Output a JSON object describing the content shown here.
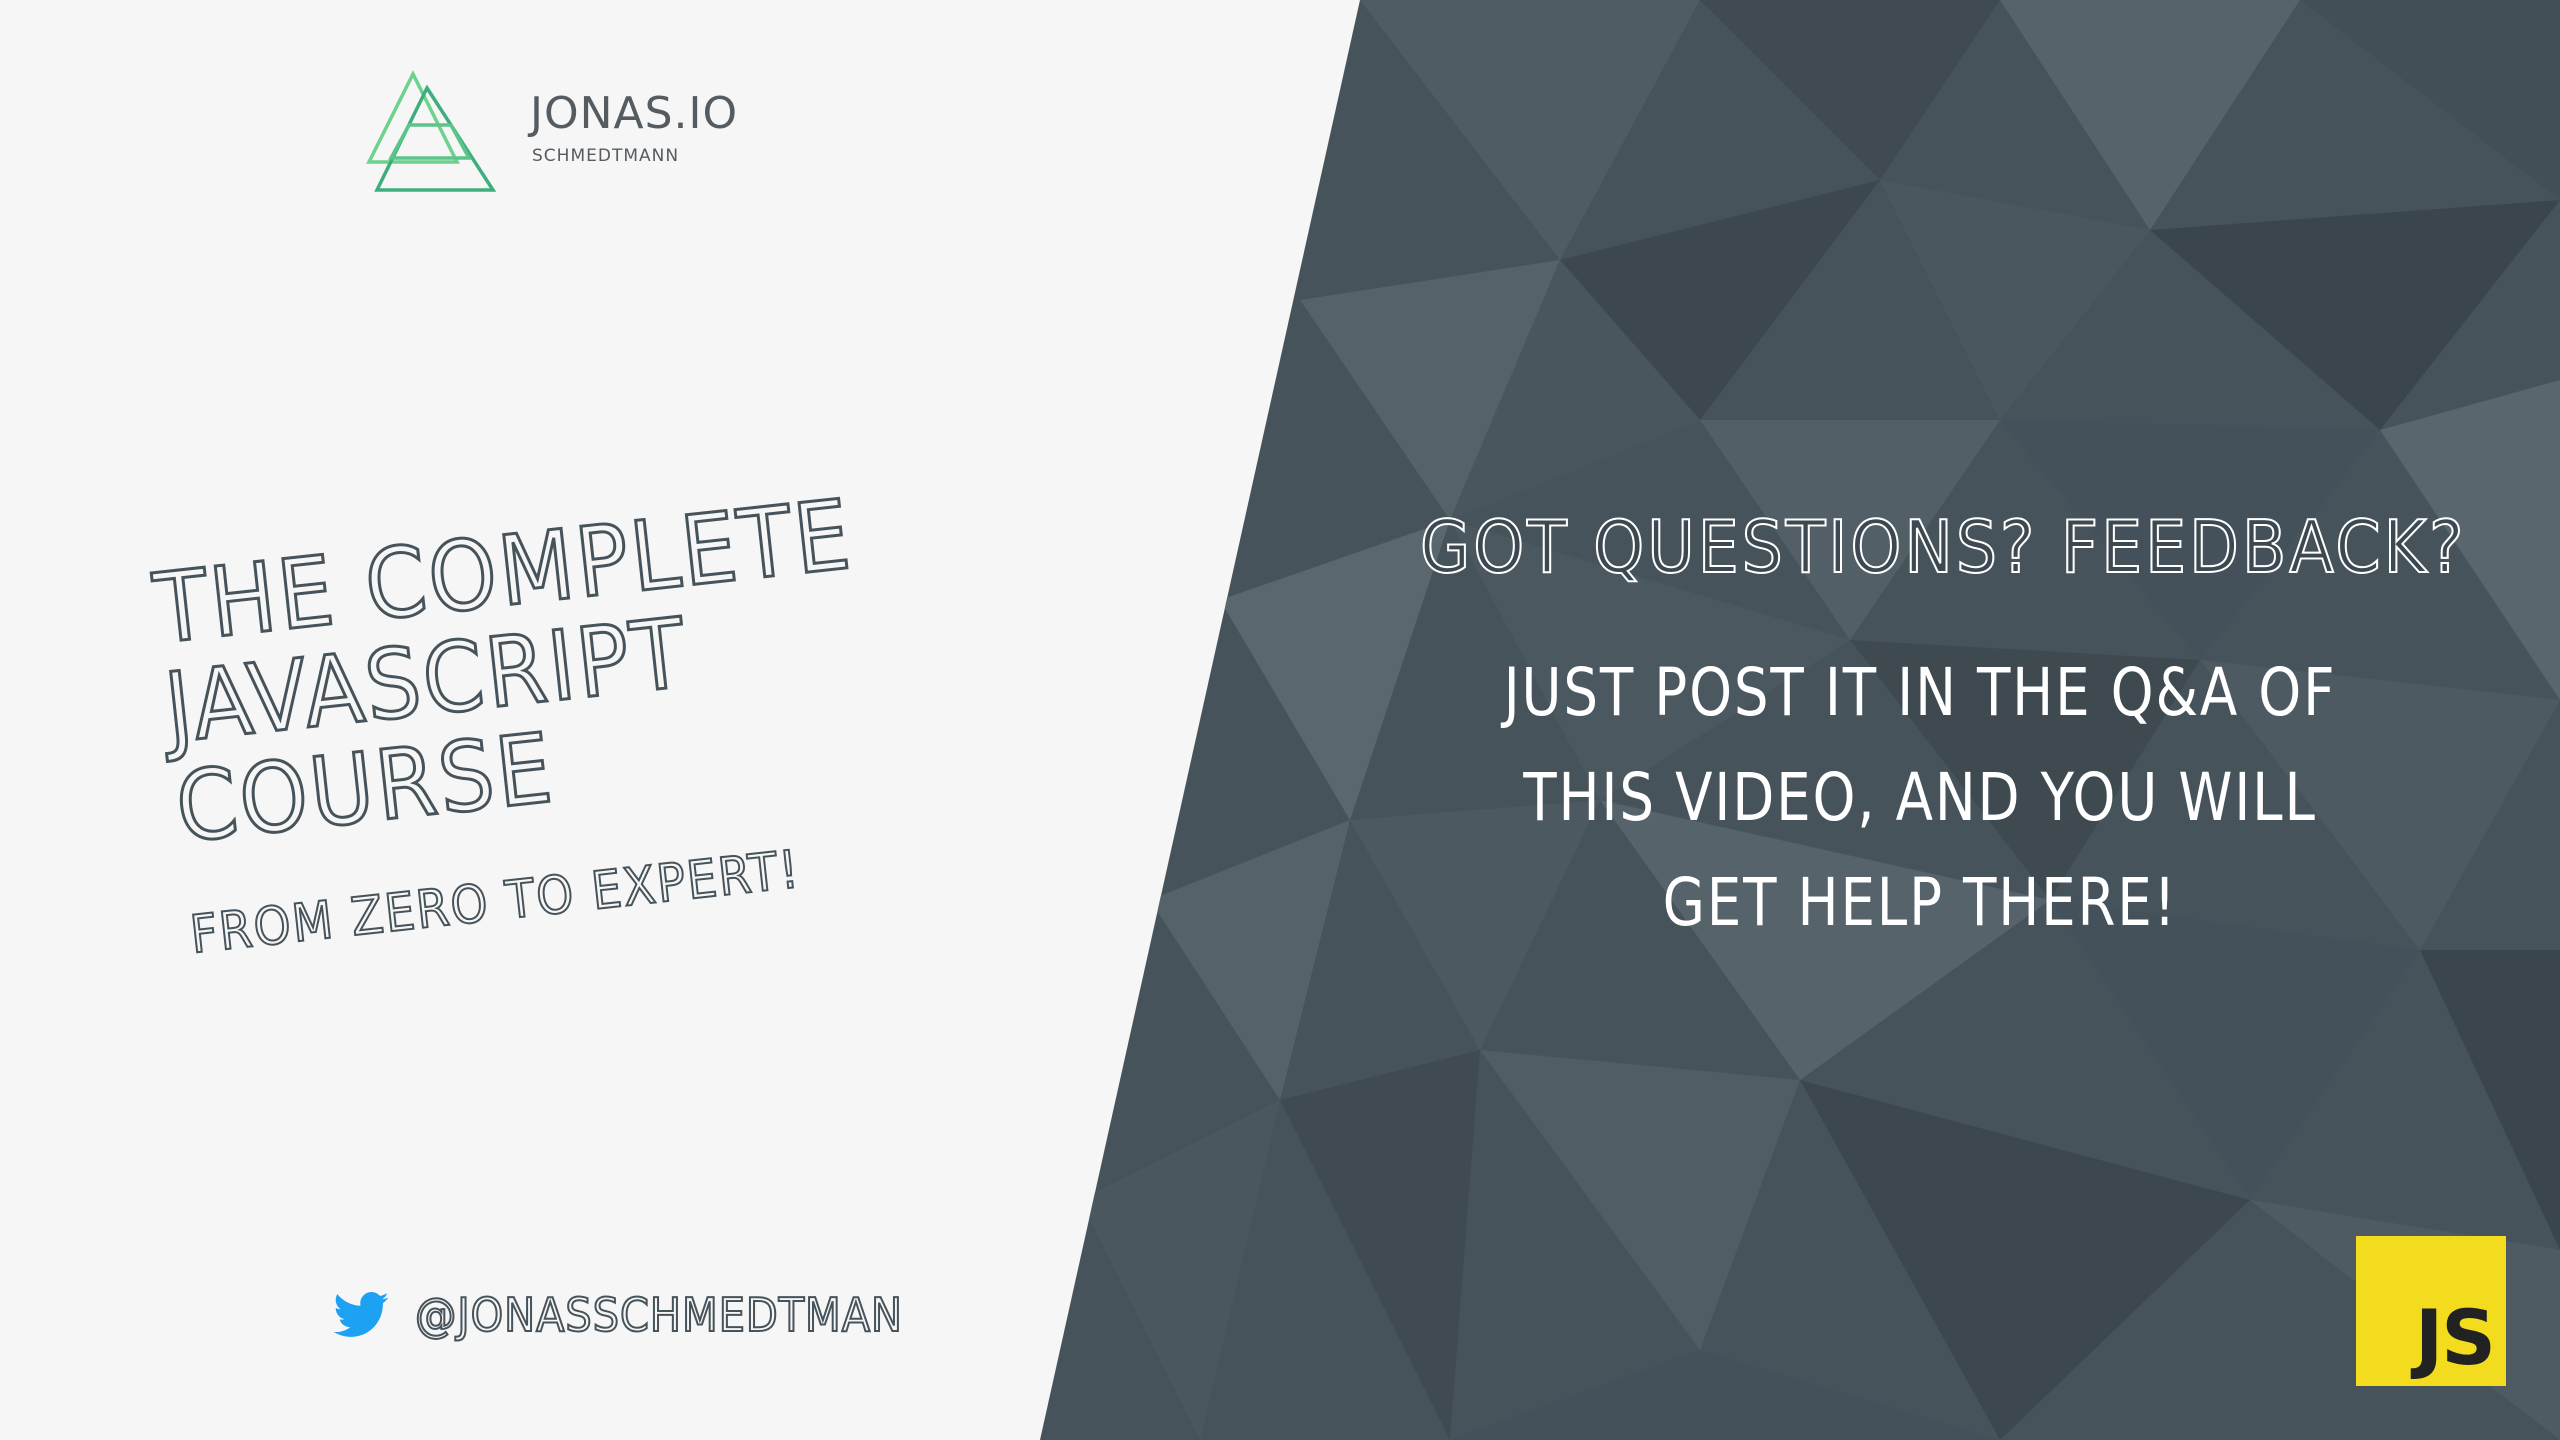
{
  "brand": {
    "name": "JONAS.IO",
    "subtitle": "SCHMEDTMANN",
    "logo_icon": "triangle-logo-icon",
    "logo_colors": [
      "#6dd28c",
      "#3fae7f"
    ]
  },
  "course": {
    "title": "THE COMPLETE\nJAVASCRIPT COURSE",
    "subtitle": "FROM ZERO TO EXPERT!"
  },
  "social": {
    "icon": "twitter-bird-icon",
    "icon_color": "#1da1f2",
    "handle": "@JONASSCHMEDTMAN"
  },
  "questions": {
    "heading": "GOT QUESTIONS? FEEDBACK?",
    "body": "JUST POST IT IN THE Q&A OF THIS VIDEO, AND YOU WILL GET HELP THERE!"
  },
  "badge": {
    "label": "JS",
    "color": "#f3dc1d"
  },
  "colors": {
    "left_background": "#f6f6f6",
    "right_background": "#46525a",
    "text_outline": "#46535b"
  }
}
